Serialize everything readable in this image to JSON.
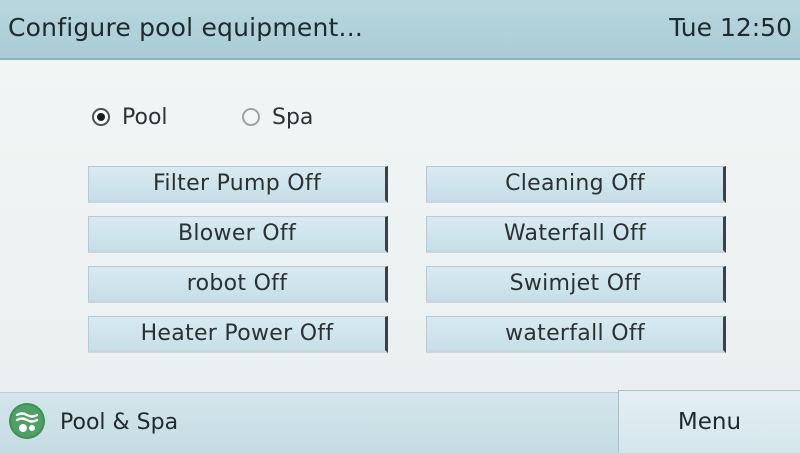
{
  "header": {
    "title": "Configure pool equipment...",
    "clock": "Tue 12:50"
  },
  "mode": {
    "options": [
      {
        "label": "Pool",
        "selected": true
      },
      {
        "label": "Spa",
        "selected": false
      }
    ]
  },
  "equipment": {
    "left": [
      "Filter Pump Off",
      "Blower Off",
      "robot Off",
      "Heater Power Off"
    ],
    "right": [
      "Cleaning Off",
      "Waterfall Off",
      "Swimjet Off",
      "waterfall Off"
    ]
  },
  "footer": {
    "app_icon": "pool-spa-icon",
    "app_label": "Pool & Spa",
    "menu_label": "Menu"
  },
  "colors": {
    "title_bar": "#a9ccd6",
    "button_fill": "#c7dfe8",
    "app_icon_green": "#3f8f56"
  }
}
